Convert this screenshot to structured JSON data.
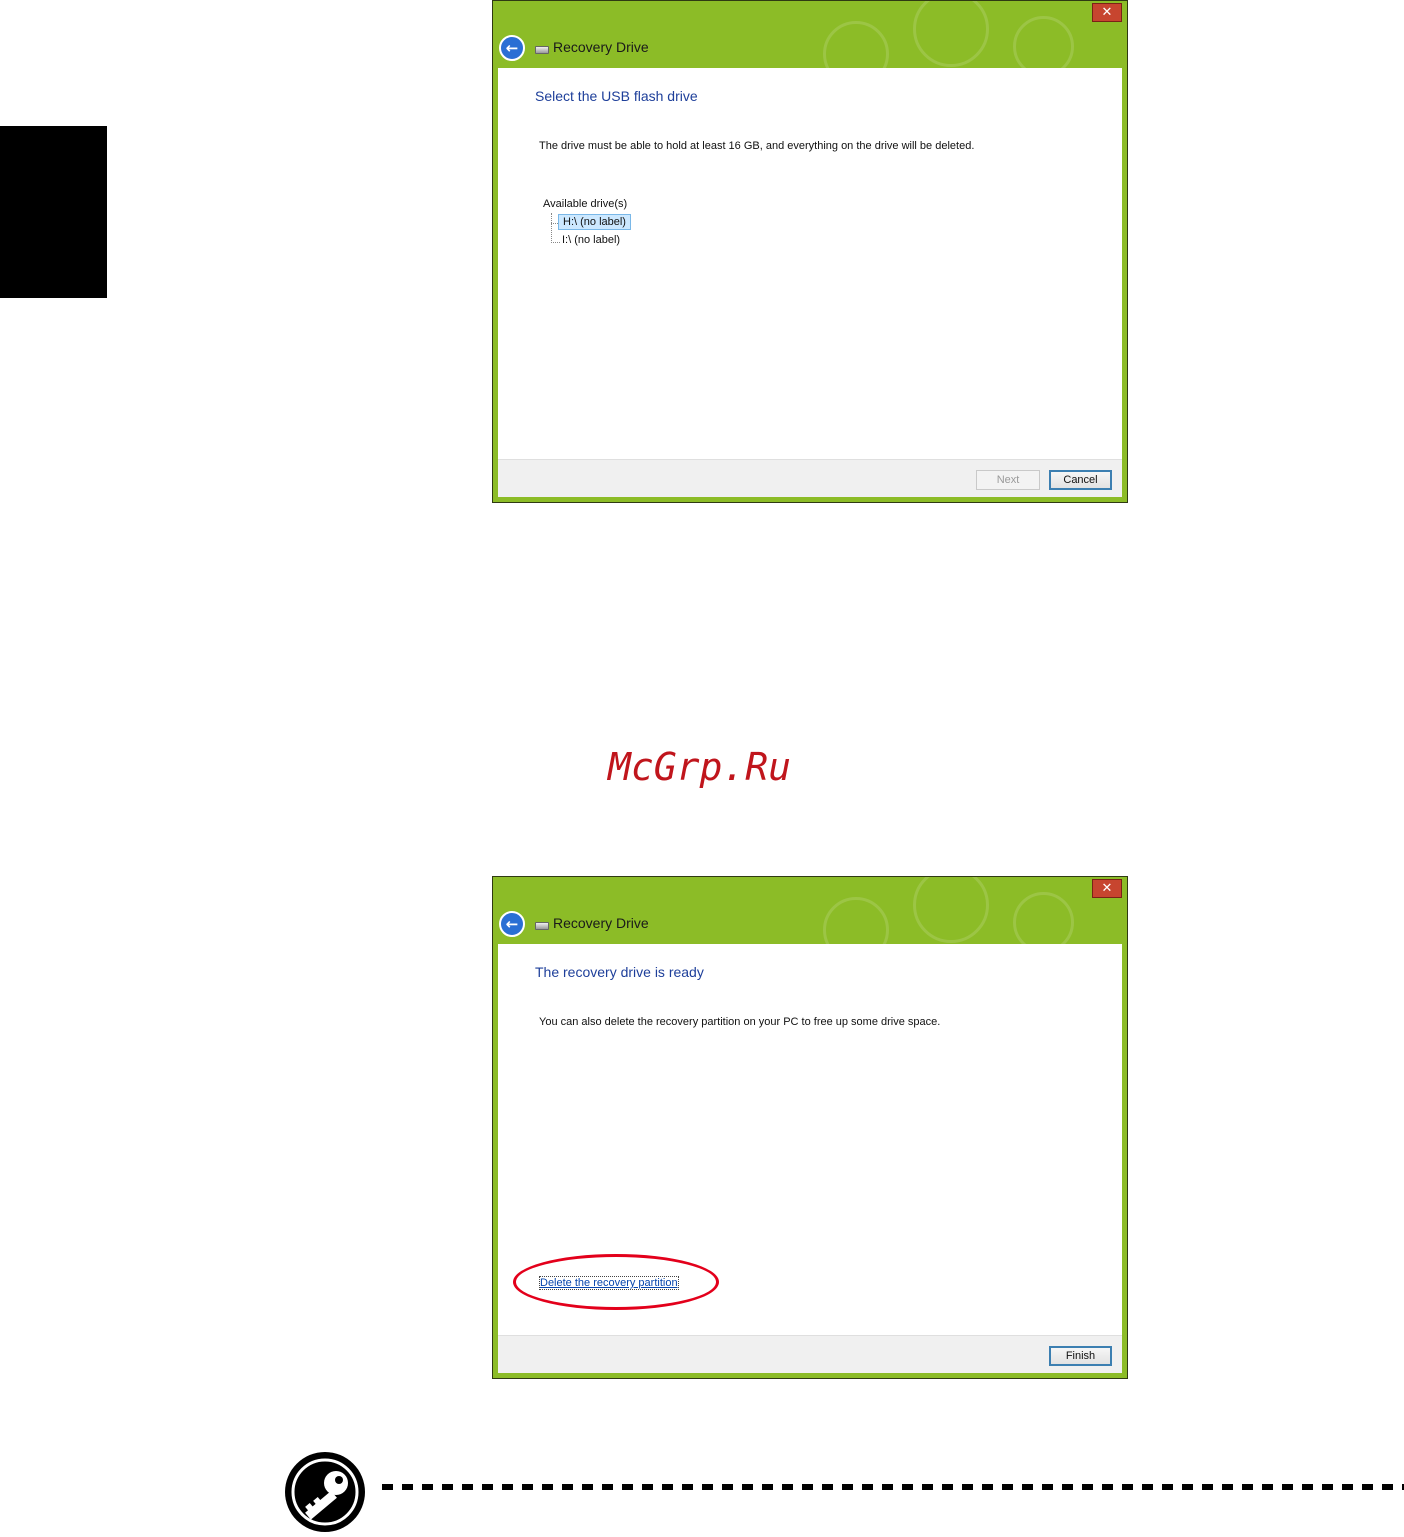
{
  "dialog1": {
    "window_title": "Recovery Drive",
    "close_glyph": "✕",
    "heading": "Select the USB flash drive",
    "description": "The drive must be able to hold at least 16 GB, and everything on the drive will be deleted.",
    "drives_label": "Available drive(s)",
    "drives": [
      {
        "label": "H:\\ (no label)",
        "selected": true
      },
      {
        "label": "I:\\ (no label)",
        "selected": false
      }
    ],
    "next_label": "Next",
    "cancel_label": "Cancel"
  },
  "dialog2": {
    "window_title": "Recovery Drive",
    "close_glyph": "✕",
    "heading": "The recovery drive is ready",
    "description": "You can also delete the recovery partition on your PC to free up some drive space.",
    "delete_link": "Delete the recovery partition",
    "finish_label": "Finish"
  },
  "watermark": "McGrp.Ru",
  "icons": {
    "back": "back-arrow-icon",
    "close": "close-icon",
    "drive": "drive-icon",
    "note": "key-icon"
  },
  "colors": {
    "titlebar_green": "#8cbc27",
    "heading_blue": "#1e3f9a",
    "highlight_red": "#e3001b",
    "watermark_red": "#c0151c"
  }
}
